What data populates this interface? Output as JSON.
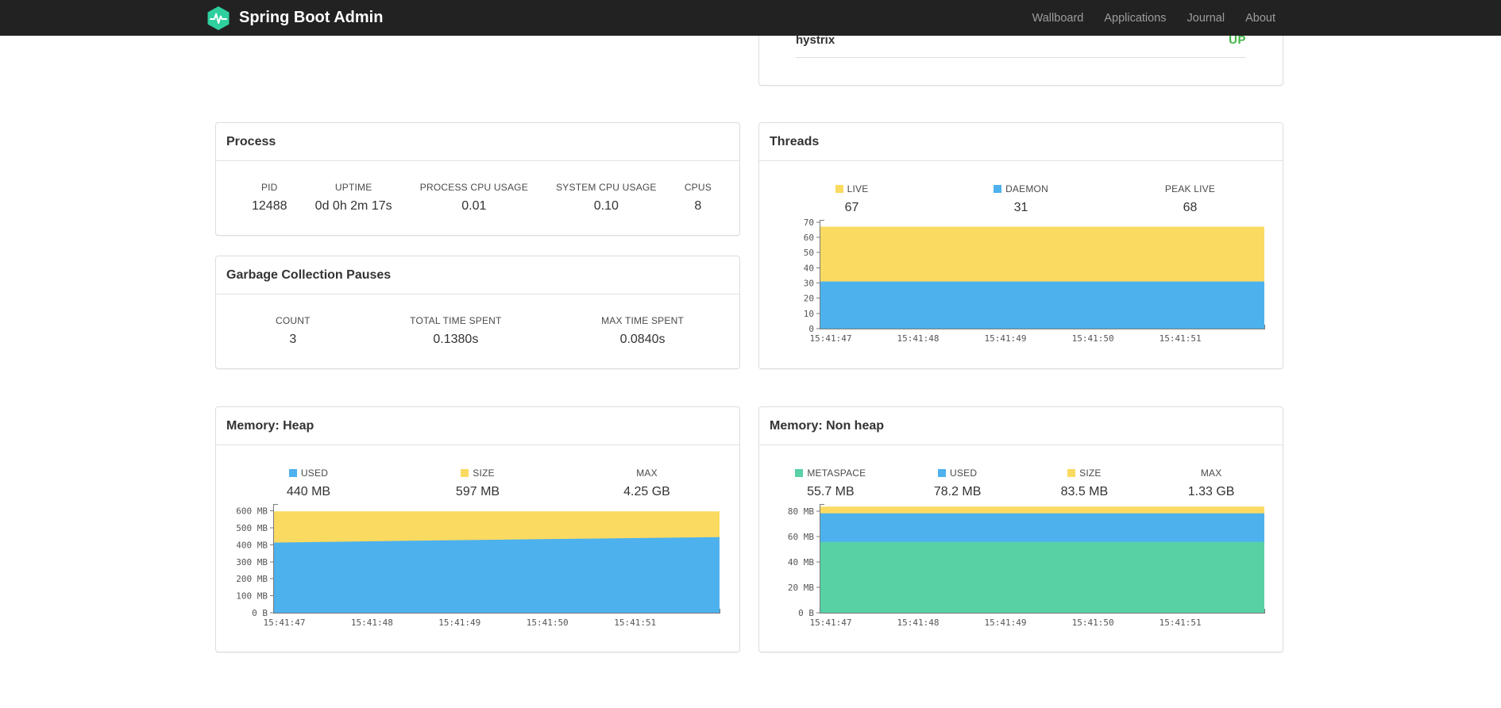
{
  "navbar": {
    "brand": "Spring Boot Admin",
    "logo_color": "#2fcf9f",
    "links": [
      {
        "label": "Wallboard"
      },
      {
        "label": "Applications"
      },
      {
        "label": "Journal"
      },
      {
        "label": "About"
      }
    ]
  },
  "status_panel": {
    "app_name": "hystrix",
    "status": "UP",
    "status_color": "#41b645"
  },
  "process": {
    "title": "Process",
    "stats": [
      {
        "label": "PID",
        "value": "12488"
      },
      {
        "label": "UPTIME",
        "value": "0d 0h 2m 17s"
      },
      {
        "label": "PROCESS CPU USAGE",
        "value": "0.01"
      },
      {
        "label": "SYSTEM CPU USAGE",
        "value": "0.10"
      },
      {
        "label": "CPUS",
        "value": "8"
      }
    ]
  },
  "gc": {
    "title": "Garbage Collection Pauses",
    "stats": [
      {
        "label": "COUNT",
        "value": "3"
      },
      {
        "label": "TOTAL TIME SPENT",
        "value": "0.1380s"
      },
      {
        "label": "MAX TIME SPENT",
        "value": "0.0840s"
      }
    ]
  },
  "threads": {
    "title": "Threads",
    "legend": [
      {
        "label": "LIVE",
        "value": "67",
        "color": "#fada61"
      },
      {
        "label": "DAEMON",
        "value": "31",
        "color": "#4db1ee"
      },
      {
        "label": "PEAK LIVE",
        "value": "68",
        "color": null
      }
    ]
  },
  "heap": {
    "title": "Memory: Heap",
    "legend": [
      {
        "label": "USED",
        "value": "440 MB",
        "color": "#4db1ee"
      },
      {
        "label": "SIZE",
        "value": "597 MB",
        "color": "#fada61"
      },
      {
        "label": "MAX",
        "value": "4.25 GB",
        "color": null
      }
    ]
  },
  "nonheap": {
    "title": "Memory: Non heap",
    "legend": [
      {
        "label": "METASPACE",
        "value": "55.7 MB",
        "color": "#58d1a5"
      },
      {
        "label": "USED",
        "value": "78.2 MB",
        "color": "#4db1ee"
      },
      {
        "label": "SIZE",
        "value": "83.5 MB",
        "color": "#fada61"
      },
      {
        "label": "MAX",
        "value": "1.33 GB",
        "color": null
      }
    ]
  },
  "chart_data": [
    {
      "id": "threads",
      "type": "area",
      "title": "Threads",
      "x_labels": [
        "15:41:47",
        "15:41:48",
        "15:41:49",
        "15:41:50",
        "15:41:51"
      ],
      "y_ticks": [
        0,
        10,
        20,
        30,
        40,
        50,
        60,
        70
      ],
      "y_tick_labels": [
        "0",
        "10",
        "20",
        "30",
        "40",
        "50",
        "60",
        "70"
      ],
      "ylim": [
        0,
        71.5
      ],
      "series": [
        {
          "name": "live",
          "color": "#fada61",
          "values": [
            67,
            67,
            67,
            67,
            67,
            67
          ]
        },
        {
          "name": "daemon",
          "color": "#4db1ee",
          "values": [
            31,
            31,
            31,
            31,
            31,
            31
          ]
        }
      ]
    },
    {
      "id": "heap",
      "type": "area",
      "title": "Memory: Heap (MB)",
      "x_labels": [
        "15:41:47",
        "15:41:48",
        "15:41:49",
        "15:41:50",
        "15:41:51"
      ],
      "y_ticks": [
        0,
        100,
        200,
        300,
        400,
        500,
        600
      ],
      "y_tick_labels": [
        "0 B",
        "100 MB",
        "200 MB",
        "300 MB",
        "400 MB",
        "500 MB",
        "600 MB"
      ],
      "ylim": [
        0,
        640
      ],
      "series": [
        {
          "name": "size",
          "color": "#fada61",
          "values": [
            597,
            597,
            597,
            597,
            597,
            597
          ]
        },
        {
          "name": "used",
          "color": "#4db1ee",
          "values": [
            413,
            420,
            427,
            433,
            439,
            445
          ]
        }
      ]
    },
    {
      "id": "nonheap",
      "type": "area",
      "title": "Memory: Non heap (MB)",
      "x_labels": [
        "15:41:47",
        "15:41:48",
        "15:41:49",
        "15:41:50",
        "15:41:51"
      ],
      "y_ticks": [
        0,
        20,
        40,
        60,
        80
      ],
      "y_tick_labels": [
        "0 B",
        "20 MB",
        "40 MB",
        "60 MB",
        "80 MB"
      ],
      "ylim": [
        0,
        85.5
      ],
      "series": [
        {
          "name": "size",
          "color": "#fada61",
          "values": [
            83.5,
            83.5,
            83.5,
            83.5,
            83.5,
            83.5
          ]
        },
        {
          "name": "used",
          "color": "#4db1ee",
          "values": [
            78.2,
            78.2,
            78.2,
            78.2,
            78.2,
            78.2
          ]
        },
        {
          "name": "metaspace",
          "color": "#58d1a5",
          "values": [
            55.7,
            55.7,
            55.7,
            55.7,
            55.7,
            55.7
          ]
        }
      ]
    }
  ]
}
